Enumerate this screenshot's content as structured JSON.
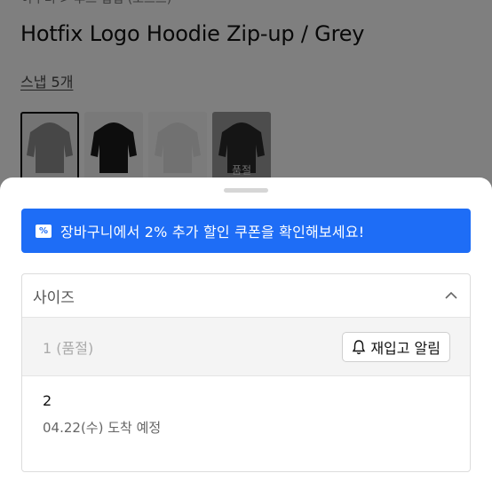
{
  "breadcrumb": "아우터 > 후드 집업 (오프트)",
  "product": {
    "title": "Hotfix Logo Hoodie Zip-up / Grey",
    "snap_link": "스냅 5개"
  },
  "thumbnails": [
    {
      "color": "#8e8e8e",
      "selected": true,
      "sold_out_label": ""
    },
    {
      "color": "#1a1a1a",
      "selected": false,
      "sold_out_label": ""
    },
    {
      "color": "#f0f0f0",
      "selected": false,
      "sold_out_label": ""
    },
    {
      "color": "#2a2a2a",
      "selected": false,
      "sold_out_label": "품절"
    }
  ],
  "banner": {
    "text": "장바구니에서 2% 추가 할인 쿠폰을 확인해보세요!",
    "icon": "coupon-icon",
    "color": "#1e6df6"
  },
  "option_select": {
    "label": "사이즈",
    "options": [
      {
        "label": "1 (품절)",
        "button": "재입고 알림",
        "button_icon": "bell-icon"
      },
      {
        "size": "2",
        "eta": "04.22(수) 도착 예정"
      }
    ]
  }
}
